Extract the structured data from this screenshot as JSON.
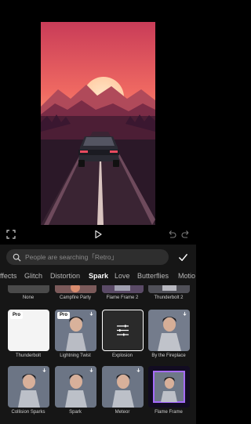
{
  "search": {
    "placeholder": "People are searching「Retro」"
  },
  "tabs": [
    {
      "label": "ffects",
      "active": false
    },
    {
      "label": "Glitch",
      "active": false
    },
    {
      "label": "Distortion",
      "active": false
    },
    {
      "label": "Spark",
      "active": true
    },
    {
      "label": "Love",
      "active": false
    },
    {
      "label": "Butterflies",
      "active": false
    },
    {
      "label": "Motio",
      "active": false
    }
  ],
  "effects": {
    "row0": [
      "None",
      "Campfire Party",
      "Flame Frame 2",
      "Thunderbolt 2"
    ],
    "row1": [
      "Thunderbolt",
      "Lightning Twist",
      "Explosion",
      "By the Fireplace"
    ],
    "row2": [
      "Collision Sparks",
      "Spark",
      "Meteor",
      "Flame Frame"
    ]
  },
  "badges": {
    "pro": "Pro"
  },
  "icons": {
    "fullscreen": "fullscreen-icon",
    "play": "play-icon",
    "undo": "undo-icon",
    "redo": "redo-icon",
    "search": "search-icon",
    "confirm": "check-icon",
    "download": "download-icon",
    "adjust": "sliders-icon"
  },
  "colors": {
    "accent": "#ffffff",
    "panel": "#161616",
    "search_bg": "#2e2e2e"
  }
}
